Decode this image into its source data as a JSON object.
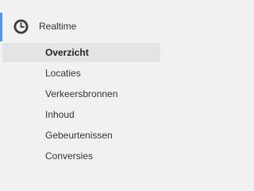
{
  "section": {
    "label": "Realtime",
    "icon": "clock-icon",
    "accent_color": "#4d90fe"
  },
  "items": [
    {
      "label": "Overzicht",
      "active": true
    },
    {
      "label": "Locaties",
      "active": false
    },
    {
      "label": "Verkeersbronnen",
      "active": false
    },
    {
      "label": "Inhoud",
      "active": false
    },
    {
      "label": "Gebeurtenissen",
      "active": false
    },
    {
      "label": "Conversies",
      "active": false
    }
  ]
}
